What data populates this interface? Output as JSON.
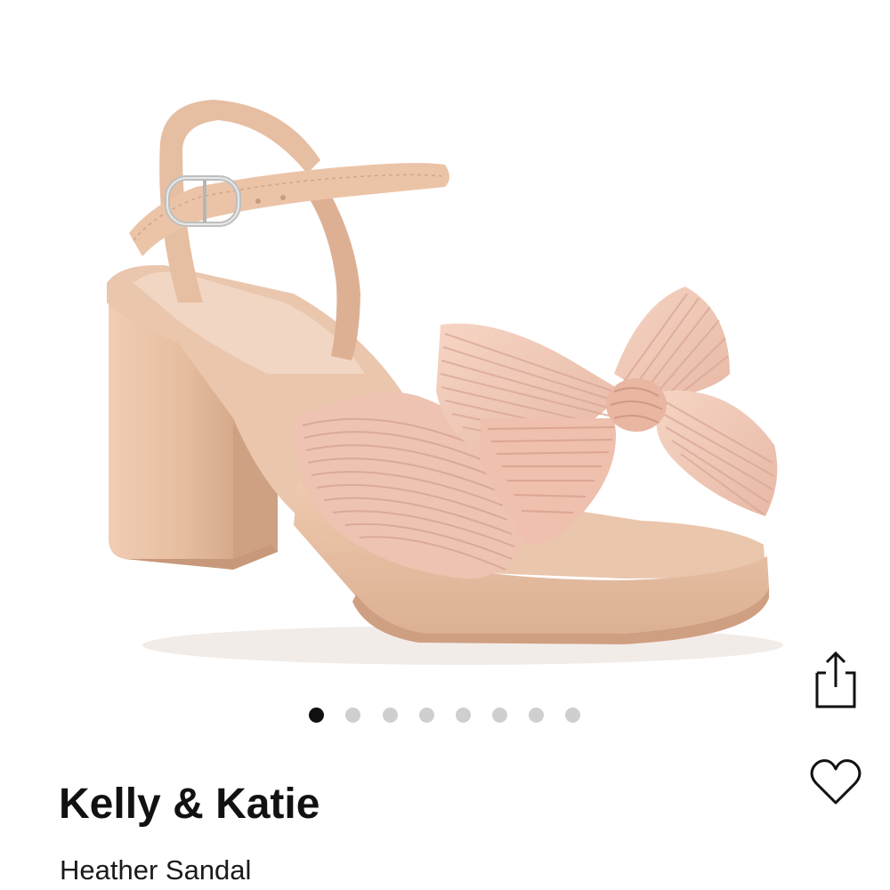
{
  "product": {
    "brand": "Kelly & Katie",
    "name": "Heather Sandal",
    "image_subject": "blush pleated bow platform block-heel sandal"
  },
  "carousel": {
    "total_images": 8,
    "active_index": 0
  },
  "actions": {
    "share_icon": "share-icon",
    "favorite_icon": "heart-icon"
  },
  "colors": {
    "shoe_main": "#e8c2a8",
    "shoe_shadow": "#d9ad91",
    "shoe_highlight": "#f3d9c6",
    "bow": "#f0c8b8",
    "dot_active": "#111111",
    "dot_inactive": "#cfcfcf"
  }
}
